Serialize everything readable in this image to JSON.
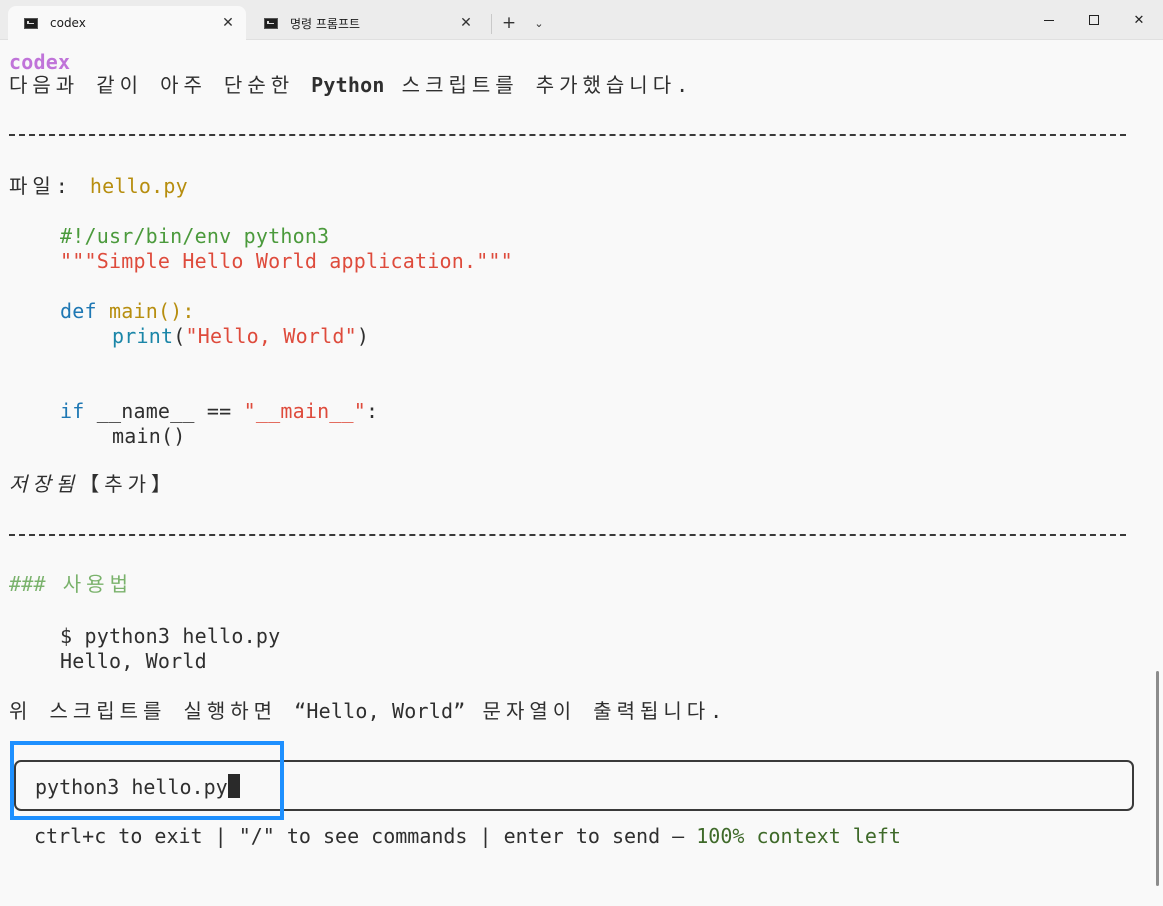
{
  "tabs": [
    {
      "label": "codex",
      "close": "✕"
    },
    {
      "label": "명령 프롬프트",
      "close": "✕"
    }
  ],
  "tab_controls": {
    "new_tab": "+",
    "dropdown": "⌄"
  },
  "window_controls": {
    "close": "✕"
  },
  "terminal": {
    "speaker": "codex",
    "intro_prefix": "다음과 같이 아주 단순한 ",
    "intro_bold": "Python",
    "intro_suffix": " 스크립트를 추가했습니다.",
    "file_label": "파일: ",
    "file_name": "hello.py",
    "code": {
      "shebang": "#!/usr/bin/env python3",
      "docstring": "\"\"\"Simple Hello World application.\"\"\"",
      "def_kw": "def",
      "def_name": " main():",
      "print_kw": "print",
      "print_open": "(",
      "print_str": "\"Hello, World\"",
      "print_close": ")",
      "if_kw": "if",
      "if_cond": " __name__ == ",
      "if_str": "\"__main__\"",
      "if_colon": ":",
      "main_call": "main()"
    },
    "saved_italic": "저장됨",
    "saved_bracket": "【추가】",
    "usage_hash": "###",
    "usage_title": " 사용법",
    "usage_cmd": "$ python3 hello.py",
    "usage_output": "Hello, World",
    "result_prefix": "위 스크립트를 실행하면 ",
    "result_quote": "“Hello, World”",
    "result_suffix": " 문자열이 출력됩니다."
  },
  "input": {
    "value": "python3 hello.py"
  },
  "footer": {
    "hint": "ctrl+c to exit | \"/\" to see commands | enter to send – ",
    "context": "100% context left"
  }
}
